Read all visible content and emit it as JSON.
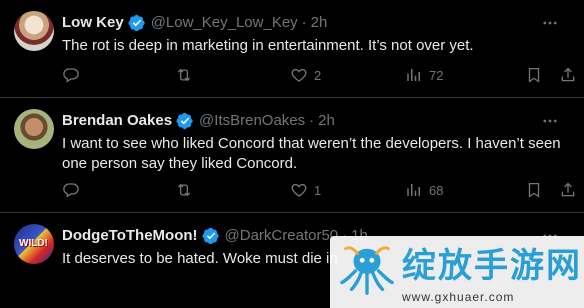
{
  "tweets": [
    {
      "name": "Low Key",
      "handle": "@Low_Key_Low_Key",
      "time": "2h",
      "text": "The rot is deep in marketing in entertainment. It’s not over yet.",
      "replies": "",
      "reposts": "",
      "likes": "2",
      "views": "72"
    },
    {
      "name": "Brendan Oakes",
      "handle": "@ItsBrenOakes",
      "time": "2h",
      "text": "I want to see who liked Concord that weren’t the developers. I haven’t seen one person say they liked Concord.",
      "replies": "",
      "reposts": "",
      "likes": "1",
      "views": "68"
    },
    {
      "name": "DodgeToTheMoon!",
      "handle": "@DarkCreator50",
      "time": "1h",
      "text": "It deserves to be hated. Woke must die in",
      "avatar_text": "WILD!"
    }
  ],
  "separator": "·",
  "watermark": {
    "title": "绽放手游网",
    "url": "www.gxhuaer.com"
  },
  "colors": {
    "background": "#000000",
    "text": "#e7e9ea",
    "muted": "#71767b",
    "verified": "#1d9bf0",
    "divider": "#2f3336",
    "watermark_brand": "#2a9fd6"
  }
}
